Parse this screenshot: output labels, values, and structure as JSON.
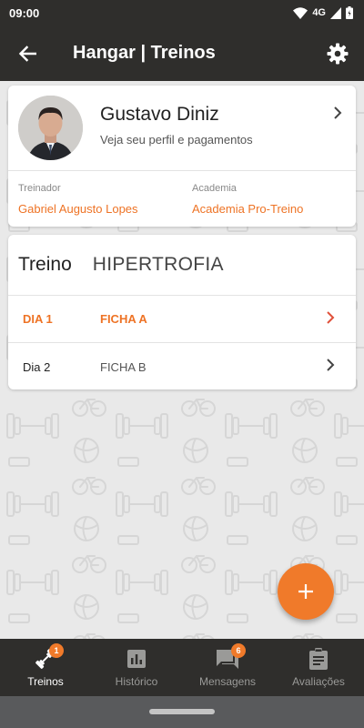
{
  "status_bar": {
    "time": "09:00",
    "network": "4G"
  },
  "app_bar": {
    "title": "Hangar | Treinos"
  },
  "profile": {
    "name": "Gustavo Diniz",
    "subtitle": "Veja seu perfil e pagamentos",
    "trainer_label": "Treinador",
    "trainer_value": "Gabriel Augusto Lopes",
    "gym_label": "Academia",
    "gym_value": "Academia Pro-Treino"
  },
  "workout": {
    "label": "Treino",
    "name": "HIPERTROFIA",
    "days": [
      {
        "day": "DIA 1",
        "sheet": "FICHA A",
        "active": true
      },
      {
        "day": "Dia 2",
        "sheet": "FICHA B",
        "active": false
      }
    ]
  },
  "fab": {
    "icon": "plus-icon"
  },
  "bottom_nav": [
    {
      "label": "Treinos",
      "icon": "dumbbell-icon",
      "badge": "1",
      "active": true
    },
    {
      "label": "Histórico",
      "icon": "bar-chart-icon",
      "badge": "",
      "active": false
    },
    {
      "label": "Mensagens",
      "icon": "chat-icon",
      "badge": "6",
      "active": false
    },
    {
      "label": "Avaliações",
      "icon": "clipboard-icon",
      "badge": "",
      "active": false
    }
  ],
  "colors": {
    "accent": "#ee7325",
    "bar": "#2f2e2c",
    "background": "#e9e9e9"
  }
}
